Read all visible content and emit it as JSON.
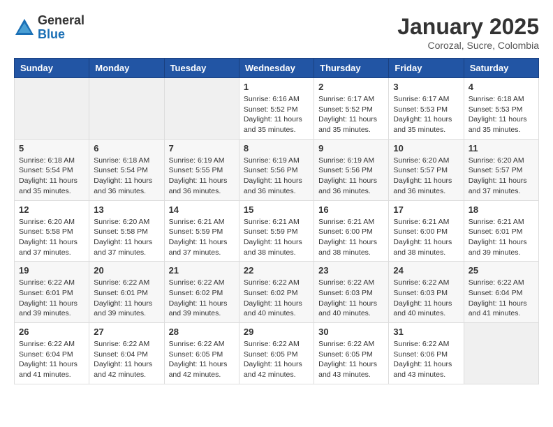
{
  "logo": {
    "general": "General",
    "blue": "Blue"
  },
  "title": "January 2025",
  "subtitle": "Corozal, Sucre, Colombia",
  "weekdays": [
    "Sunday",
    "Monday",
    "Tuesday",
    "Wednesday",
    "Thursday",
    "Friday",
    "Saturday"
  ],
  "weeks": [
    [
      {
        "day": "",
        "info": ""
      },
      {
        "day": "",
        "info": ""
      },
      {
        "day": "",
        "info": ""
      },
      {
        "day": "1",
        "info": "Sunrise: 6:16 AM\nSunset: 5:52 PM\nDaylight: 11 hours and 35 minutes."
      },
      {
        "day": "2",
        "info": "Sunrise: 6:17 AM\nSunset: 5:52 PM\nDaylight: 11 hours and 35 minutes."
      },
      {
        "day": "3",
        "info": "Sunrise: 6:17 AM\nSunset: 5:53 PM\nDaylight: 11 hours and 35 minutes."
      },
      {
        "day": "4",
        "info": "Sunrise: 6:18 AM\nSunset: 5:53 PM\nDaylight: 11 hours and 35 minutes."
      }
    ],
    [
      {
        "day": "5",
        "info": "Sunrise: 6:18 AM\nSunset: 5:54 PM\nDaylight: 11 hours and 35 minutes."
      },
      {
        "day": "6",
        "info": "Sunrise: 6:18 AM\nSunset: 5:54 PM\nDaylight: 11 hours and 36 minutes."
      },
      {
        "day": "7",
        "info": "Sunrise: 6:19 AM\nSunset: 5:55 PM\nDaylight: 11 hours and 36 minutes."
      },
      {
        "day": "8",
        "info": "Sunrise: 6:19 AM\nSunset: 5:56 PM\nDaylight: 11 hours and 36 minutes."
      },
      {
        "day": "9",
        "info": "Sunrise: 6:19 AM\nSunset: 5:56 PM\nDaylight: 11 hours and 36 minutes."
      },
      {
        "day": "10",
        "info": "Sunrise: 6:20 AM\nSunset: 5:57 PM\nDaylight: 11 hours and 36 minutes."
      },
      {
        "day": "11",
        "info": "Sunrise: 6:20 AM\nSunset: 5:57 PM\nDaylight: 11 hours and 37 minutes."
      }
    ],
    [
      {
        "day": "12",
        "info": "Sunrise: 6:20 AM\nSunset: 5:58 PM\nDaylight: 11 hours and 37 minutes."
      },
      {
        "day": "13",
        "info": "Sunrise: 6:20 AM\nSunset: 5:58 PM\nDaylight: 11 hours and 37 minutes."
      },
      {
        "day": "14",
        "info": "Sunrise: 6:21 AM\nSunset: 5:59 PM\nDaylight: 11 hours and 37 minutes."
      },
      {
        "day": "15",
        "info": "Sunrise: 6:21 AM\nSunset: 5:59 PM\nDaylight: 11 hours and 38 minutes."
      },
      {
        "day": "16",
        "info": "Sunrise: 6:21 AM\nSunset: 6:00 PM\nDaylight: 11 hours and 38 minutes."
      },
      {
        "day": "17",
        "info": "Sunrise: 6:21 AM\nSunset: 6:00 PM\nDaylight: 11 hours and 38 minutes."
      },
      {
        "day": "18",
        "info": "Sunrise: 6:21 AM\nSunset: 6:01 PM\nDaylight: 11 hours and 39 minutes."
      }
    ],
    [
      {
        "day": "19",
        "info": "Sunrise: 6:22 AM\nSunset: 6:01 PM\nDaylight: 11 hours and 39 minutes."
      },
      {
        "day": "20",
        "info": "Sunrise: 6:22 AM\nSunset: 6:01 PM\nDaylight: 11 hours and 39 minutes."
      },
      {
        "day": "21",
        "info": "Sunrise: 6:22 AM\nSunset: 6:02 PM\nDaylight: 11 hours and 39 minutes."
      },
      {
        "day": "22",
        "info": "Sunrise: 6:22 AM\nSunset: 6:02 PM\nDaylight: 11 hours and 40 minutes."
      },
      {
        "day": "23",
        "info": "Sunrise: 6:22 AM\nSunset: 6:03 PM\nDaylight: 11 hours and 40 minutes."
      },
      {
        "day": "24",
        "info": "Sunrise: 6:22 AM\nSunset: 6:03 PM\nDaylight: 11 hours and 40 minutes."
      },
      {
        "day": "25",
        "info": "Sunrise: 6:22 AM\nSunset: 6:04 PM\nDaylight: 11 hours and 41 minutes."
      }
    ],
    [
      {
        "day": "26",
        "info": "Sunrise: 6:22 AM\nSunset: 6:04 PM\nDaylight: 11 hours and 41 minutes."
      },
      {
        "day": "27",
        "info": "Sunrise: 6:22 AM\nSunset: 6:04 PM\nDaylight: 11 hours and 42 minutes."
      },
      {
        "day": "28",
        "info": "Sunrise: 6:22 AM\nSunset: 6:05 PM\nDaylight: 11 hours and 42 minutes."
      },
      {
        "day": "29",
        "info": "Sunrise: 6:22 AM\nSunset: 6:05 PM\nDaylight: 11 hours and 42 minutes."
      },
      {
        "day": "30",
        "info": "Sunrise: 6:22 AM\nSunset: 6:05 PM\nDaylight: 11 hours and 43 minutes."
      },
      {
        "day": "31",
        "info": "Sunrise: 6:22 AM\nSunset: 6:06 PM\nDaylight: 11 hours and 43 minutes."
      },
      {
        "day": "",
        "info": ""
      }
    ]
  ]
}
